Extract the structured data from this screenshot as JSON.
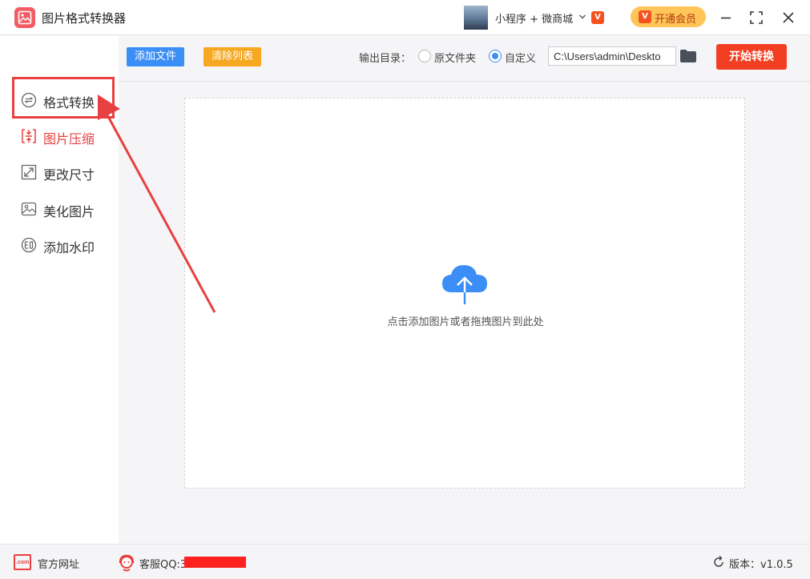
{
  "window": {
    "title": "图片格式转换器",
    "mini_program_link": "小程序 + 微商城",
    "vip_badge": "V",
    "vip_button": "开通会员"
  },
  "toolbar": {
    "add_files": "添加文件",
    "clear_list": "清除列表",
    "output_dir_label": "输出目录：",
    "option_original": "原文件夹",
    "option_custom": "自定义",
    "selected_option": "自定义",
    "output_path": "C:\\Users\\admin\\Deskto",
    "start_convert": "开始转换"
  },
  "sidebar": {
    "items": [
      {
        "label": "格式转换",
        "icon": "format-convert-icon",
        "highlighted": true
      },
      {
        "label": "图片压缩",
        "icon": "compress-icon",
        "active": true
      },
      {
        "label": "更改尺寸",
        "icon": "resize-icon"
      },
      {
        "label": "美化图片",
        "icon": "beautify-icon"
      },
      {
        "label": "添加水印",
        "icon": "watermark-icon"
      }
    ]
  },
  "dropzone": {
    "hint": "点击添加图片或者拖拽图片到此处",
    "icon": "cloud-upload-icon"
  },
  "footer": {
    "website_label": "官方网址",
    "website_icon_text": ".com",
    "support_label": "客服QQ:3",
    "version_label": "版本：v1.0.5"
  },
  "colors": {
    "accent_blue": "#3b8ef5",
    "accent_orange": "#f6a821",
    "start_red": "#f23f22",
    "highlight_red": "#e84040",
    "vip_yellow": "#ffc558"
  }
}
